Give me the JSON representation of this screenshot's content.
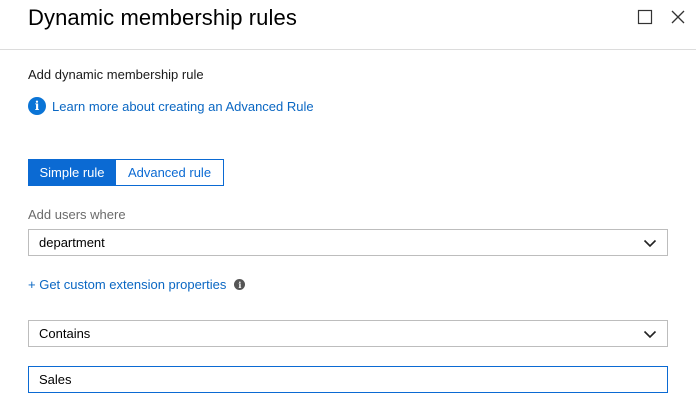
{
  "header": {
    "title": "Dynamic membership rules",
    "maximize_icon": "maximize-icon",
    "close_icon": "close-icon"
  },
  "main": {
    "section_label": "Add dynamic membership rule",
    "learn_more_link": "Learn more about creating an Advanced Rule",
    "tabs": [
      {
        "label": "Simple rule",
        "selected": true
      },
      {
        "label": "Advanced rule",
        "selected": false
      }
    ],
    "attribute_label": "Add users where",
    "attribute_select": {
      "value": "department"
    },
    "custom_extension_link": "+ Get custom extension properties",
    "operator_select": {
      "value": "Contains"
    },
    "value_input": {
      "value": "Sales"
    }
  },
  "colors": {
    "accent": "#0b6ad3",
    "link": "#0a67c3"
  }
}
